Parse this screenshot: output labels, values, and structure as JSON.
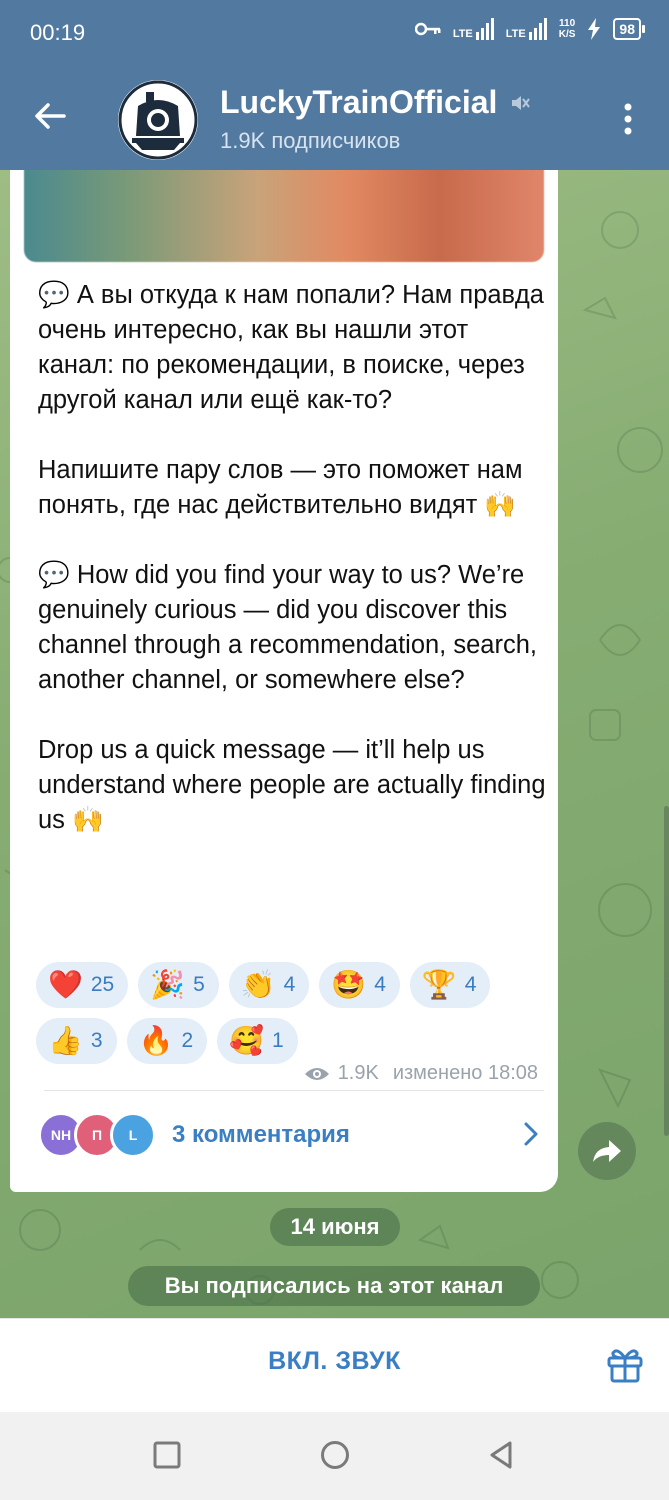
{
  "status_bar": {
    "time": "00:19",
    "network1": "LTE",
    "network2": "LTE",
    "speed_value": "110",
    "speed_unit": "K/S",
    "battery": "98"
  },
  "header": {
    "channel_name": "LuckyTrainOfficial",
    "subscribers": "1.9K подписчиков",
    "muted": true
  },
  "message": {
    "text": "💬 А вы откуда к нам попали? Нам правда очень интересно, как вы нашли этот канал: по рекомендации, в поиске, через другой канал или ещё как-то?\n\nНапишите пару слов — это поможет нам понять, где нас действительно видят 🙌\n\n💬 How did you find your way to us? We’re genuinely curious — did you discover this channel through a recommendation, search, another channel, or somewhere else?\n\nDrop us a quick message — it’ll help us understand where people are actually finding us 🙌",
    "reactions": [
      {
        "emoji": "❤️",
        "count": "25"
      },
      {
        "emoji": "🎉",
        "count": "5"
      },
      {
        "emoji": "👏",
        "count": "4"
      },
      {
        "emoji": "🤩",
        "count": "4"
      },
      {
        "emoji": "🏆",
        "count": "4"
      },
      {
        "emoji": "👍",
        "count": "3"
      },
      {
        "emoji": "🔥",
        "count": "2"
      },
      {
        "emoji": "🥰",
        "count": "1"
      }
    ],
    "views": "1.9K",
    "edited": "изменено 18:08",
    "comment_avatars": [
      "NH",
      "П",
      "L"
    ],
    "comments_label": "3 комментария"
  },
  "date_chip": "14 июня",
  "service_message": "Вы подписались на этот канал",
  "bottom_bar": {
    "unmute_label": "ВКЛ. ЗВУК"
  },
  "colors": {
    "header": "#527aa1",
    "accent": "#3a7fc4",
    "reaction_bg": "#e4eef8"
  }
}
